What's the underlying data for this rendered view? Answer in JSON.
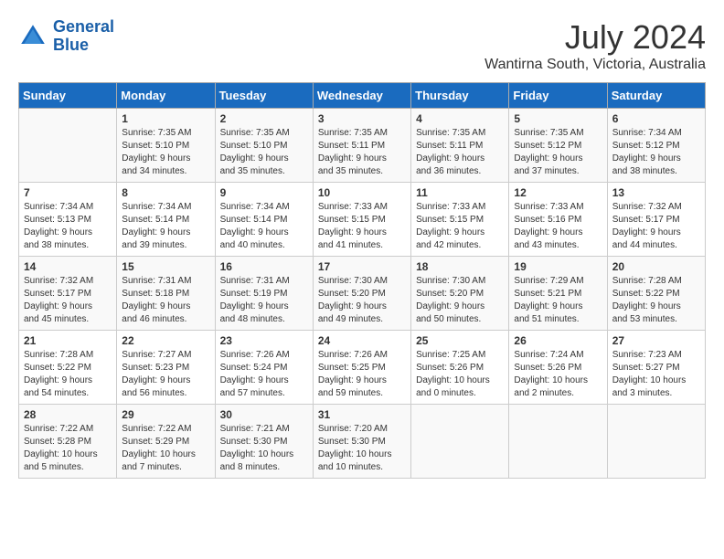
{
  "header": {
    "logo_line1": "General",
    "logo_line2": "Blue",
    "title": "July 2024",
    "subtitle": "Wantirna South, Victoria, Australia"
  },
  "columns": [
    "Sunday",
    "Monday",
    "Tuesday",
    "Wednesday",
    "Thursday",
    "Friday",
    "Saturday"
  ],
  "weeks": [
    [
      {
        "day": "",
        "info": ""
      },
      {
        "day": "1",
        "info": "Sunrise: 7:35 AM\nSunset: 5:10 PM\nDaylight: 9 hours\nand 34 minutes."
      },
      {
        "day": "2",
        "info": "Sunrise: 7:35 AM\nSunset: 5:10 PM\nDaylight: 9 hours\nand 35 minutes."
      },
      {
        "day": "3",
        "info": "Sunrise: 7:35 AM\nSunset: 5:11 PM\nDaylight: 9 hours\nand 35 minutes."
      },
      {
        "day": "4",
        "info": "Sunrise: 7:35 AM\nSunset: 5:11 PM\nDaylight: 9 hours\nand 36 minutes."
      },
      {
        "day": "5",
        "info": "Sunrise: 7:35 AM\nSunset: 5:12 PM\nDaylight: 9 hours\nand 37 minutes."
      },
      {
        "day": "6",
        "info": "Sunrise: 7:34 AM\nSunset: 5:12 PM\nDaylight: 9 hours\nand 38 minutes."
      }
    ],
    [
      {
        "day": "7",
        "info": "Sunrise: 7:34 AM\nSunset: 5:13 PM\nDaylight: 9 hours\nand 38 minutes."
      },
      {
        "day": "8",
        "info": "Sunrise: 7:34 AM\nSunset: 5:14 PM\nDaylight: 9 hours\nand 39 minutes."
      },
      {
        "day": "9",
        "info": "Sunrise: 7:34 AM\nSunset: 5:14 PM\nDaylight: 9 hours\nand 40 minutes."
      },
      {
        "day": "10",
        "info": "Sunrise: 7:33 AM\nSunset: 5:15 PM\nDaylight: 9 hours\nand 41 minutes."
      },
      {
        "day": "11",
        "info": "Sunrise: 7:33 AM\nSunset: 5:15 PM\nDaylight: 9 hours\nand 42 minutes."
      },
      {
        "day": "12",
        "info": "Sunrise: 7:33 AM\nSunset: 5:16 PM\nDaylight: 9 hours\nand 43 minutes."
      },
      {
        "day": "13",
        "info": "Sunrise: 7:32 AM\nSunset: 5:17 PM\nDaylight: 9 hours\nand 44 minutes."
      }
    ],
    [
      {
        "day": "14",
        "info": "Sunrise: 7:32 AM\nSunset: 5:17 PM\nDaylight: 9 hours\nand 45 minutes."
      },
      {
        "day": "15",
        "info": "Sunrise: 7:31 AM\nSunset: 5:18 PM\nDaylight: 9 hours\nand 46 minutes."
      },
      {
        "day": "16",
        "info": "Sunrise: 7:31 AM\nSunset: 5:19 PM\nDaylight: 9 hours\nand 48 minutes."
      },
      {
        "day": "17",
        "info": "Sunrise: 7:30 AM\nSunset: 5:20 PM\nDaylight: 9 hours\nand 49 minutes."
      },
      {
        "day": "18",
        "info": "Sunrise: 7:30 AM\nSunset: 5:20 PM\nDaylight: 9 hours\nand 50 minutes."
      },
      {
        "day": "19",
        "info": "Sunrise: 7:29 AM\nSunset: 5:21 PM\nDaylight: 9 hours\nand 51 minutes."
      },
      {
        "day": "20",
        "info": "Sunrise: 7:28 AM\nSunset: 5:22 PM\nDaylight: 9 hours\nand 53 minutes."
      }
    ],
    [
      {
        "day": "21",
        "info": "Sunrise: 7:28 AM\nSunset: 5:22 PM\nDaylight: 9 hours\nand 54 minutes."
      },
      {
        "day": "22",
        "info": "Sunrise: 7:27 AM\nSunset: 5:23 PM\nDaylight: 9 hours\nand 56 minutes."
      },
      {
        "day": "23",
        "info": "Sunrise: 7:26 AM\nSunset: 5:24 PM\nDaylight: 9 hours\nand 57 minutes."
      },
      {
        "day": "24",
        "info": "Sunrise: 7:26 AM\nSunset: 5:25 PM\nDaylight: 9 hours\nand 59 minutes."
      },
      {
        "day": "25",
        "info": "Sunrise: 7:25 AM\nSunset: 5:26 PM\nDaylight: 10 hours\nand 0 minutes."
      },
      {
        "day": "26",
        "info": "Sunrise: 7:24 AM\nSunset: 5:26 PM\nDaylight: 10 hours\nand 2 minutes."
      },
      {
        "day": "27",
        "info": "Sunrise: 7:23 AM\nSunset: 5:27 PM\nDaylight: 10 hours\nand 3 minutes."
      }
    ],
    [
      {
        "day": "28",
        "info": "Sunrise: 7:22 AM\nSunset: 5:28 PM\nDaylight: 10 hours\nand 5 minutes."
      },
      {
        "day": "29",
        "info": "Sunrise: 7:22 AM\nSunset: 5:29 PM\nDaylight: 10 hours\nand 7 minutes."
      },
      {
        "day": "30",
        "info": "Sunrise: 7:21 AM\nSunset: 5:30 PM\nDaylight: 10 hours\nand 8 minutes."
      },
      {
        "day": "31",
        "info": "Sunrise: 7:20 AM\nSunset: 5:30 PM\nDaylight: 10 hours\nand 10 minutes."
      },
      {
        "day": "",
        "info": ""
      },
      {
        "day": "",
        "info": ""
      },
      {
        "day": "",
        "info": ""
      }
    ]
  ]
}
